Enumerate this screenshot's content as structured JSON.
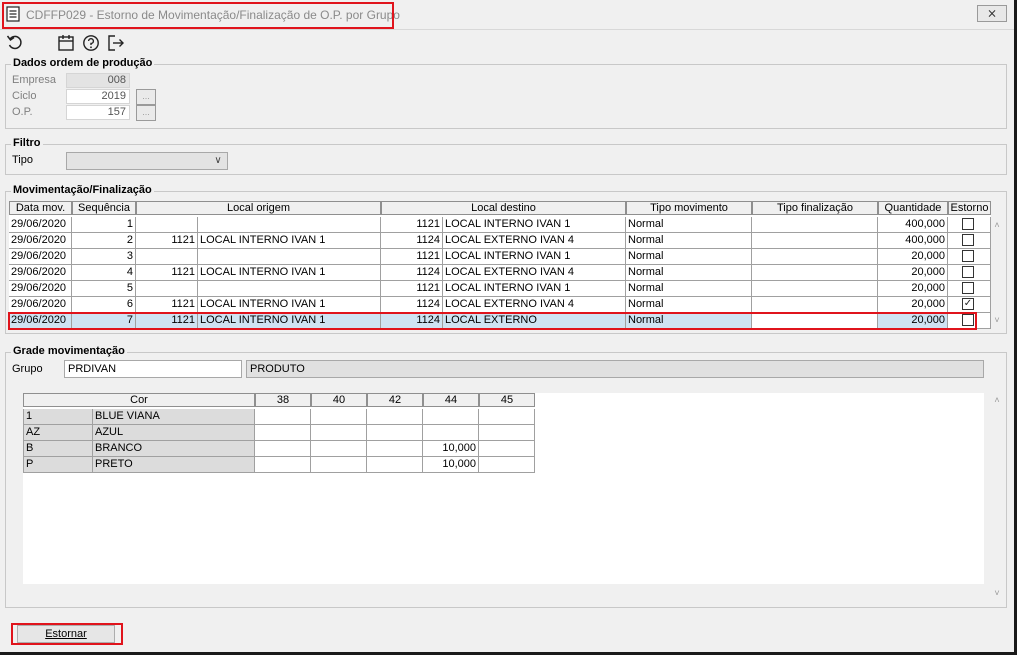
{
  "window": {
    "title": "CDFFP029 - Estorno de Movimentação/Finalização de O.P. por Grupo",
    "close_glyph": "⨯"
  },
  "toolbar": {
    "icons": [
      "undo-icon",
      "calendar-icon",
      "help-icon",
      "exit-icon"
    ]
  },
  "dados": {
    "legend": "Dados ordem de produção",
    "empresa_label": "Empresa",
    "empresa_value": "008",
    "ciclo_label": "Ciclo",
    "ciclo_value": "2019",
    "op_label": "O.P.",
    "op_value": "157",
    "lookup_glyph": "…"
  },
  "filtro": {
    "legend": "Filtro",
    "tipo_label": "Tipo",
    "tipo_value": "",
    "arrow": "∨"
  },
  "mov": {
    "legend": "Movimentação/Finalização",
    "headers": {
      "data": "Data mov.",
      "seq": "Sequência",
      "origem": "Local origem",
      "destino": "Local destino",
      "tipo_mov": "Tipo movimento",
      "tipo_fin": "Tipo finalização",
      "qtd": "Quantidade",
      "estorno": "Estorno"
    },
    "rows": [
      {
        "data": "29/06/2020",
        "seq": "1",
        "orig_cod": "",
        "orig_nome": "",
        "dest_cod": "1121",
        "dest_nome": "LOCAL INTERNO IVAN 1",
        "tipo": "Normal",
        "fin": "",
        "qtd": "400,000",
        "estorno": ""
      },
      {
        "data": "29/06/2020",
        "seq": "2",
        "orig_cod": "1121",
        "orig_nome": "LOCAL INTERNO IVAN 1",
        "dest_cod": "1124",
        "dest_nome": "LOCAL EXTERNO IVAN 4",
        "tipo": "Normal",
        "fin": "",
        "qtd": "400,000",
        "estorno": ""
      },
      {
        "data": "29/06/2020",
        "seq": "3",
        "orig_cod": "",
        "orig_nome": "",
        "dest_cod": "1121",
        "dest_nome": "LOCAL INTERNO IVAN 1",
        "tipo": "Normal",
        "fin": "",
        "qtd": "20,000",
        "estorno": ""
      },
      {
        "data": "29/06/2020",
        "seq": "4",
        "orig_cod": "1121",
        "orig_nome": "LOCAL INTERNO IVAN 1",
        "dest_cod": "1124",
        "dest_nome": "LOCAL EXTERNO IVAN 4",
        "tipo": "Normal",
        "fin": "",
        "qtd": "20,000",
        "estorno": ""
      },
      {
        "data": "29/06/2020",
        "seq": "5",
        "orig_cod": "",
        "orig_nome": "",
        "dest_cod": "1121",
        "dest_nome": "LOCAL INTERNO IVAN 1",
        "tipo": "Normal",
        "fin": "",
        "qtd": "20,000",
        "estorno": ""
      },
      {
        "data": "29/06/2020",
        "seq": "6",
        "orig_cod": "1121",
        "orig_nome": "LOCAL INTERNO IVAN 1",
        "dest_cod": "1124",
        "dest_nome": "LOCAL EXTERNO IVAN 4",
        "tipo": "Normal",
        "fin": "",
        "qtd": "20,000",
        "estorno": "✓"
      },
      {
        "data": "29/06/2020",
        "seq": "7",
        "orig_cod": "1121",
        "orig_nome": "LOCAL INTERNO IVAN 1",
        "dest_cod": "1124",
        "dest_nome": "LOCAL EXTERNO",
        "tipo": "Normal",
        "fin": "",
        "qtd": "20,000",
        "estorno": ""
      }
    ],
    "scroll_up": "˄",
    "scroll_down": "˅"
  },
  "grade": {
    "legend": "Grade movimentação",
    "grupo_label": "Grupo",
    "grupo_code": "PRDIVAN",
    "grupo_desc": "PRODUTO",
    "cor_header": "Cor",
    "sizes": [
      "38",
      "40",
      "42",
      "44",
      "45"
    ],
    "rows": [
      {
        "cod": "1",
        "nome": "BLUE VIANA",
        "vals": [
          "",
          "",
          "",
          "",
          ""
        ]
      },
      {
        "cod": "AZ",
        "nome": "AZUL",
        "vals": [
          "",
          "",
          "",
          "",
          ""
        ]
      },
      {
        "cod": "B",
        "nome": "BRANCO",
        "vals": [
          "",
          "",
          "",
          "10,000",
          ""
        ]
      },
      {
        "cod": "P",
        "nome": "PRETO",
        "vals": [
          "",
          "",
          "",
          "10,000",
          ""
        ]
      }
    ],
    "scroll_up": "˄",
    "scroll_down": "˅"
  },
  "actions": {
    "estornar": "Estornar"
  }
}
